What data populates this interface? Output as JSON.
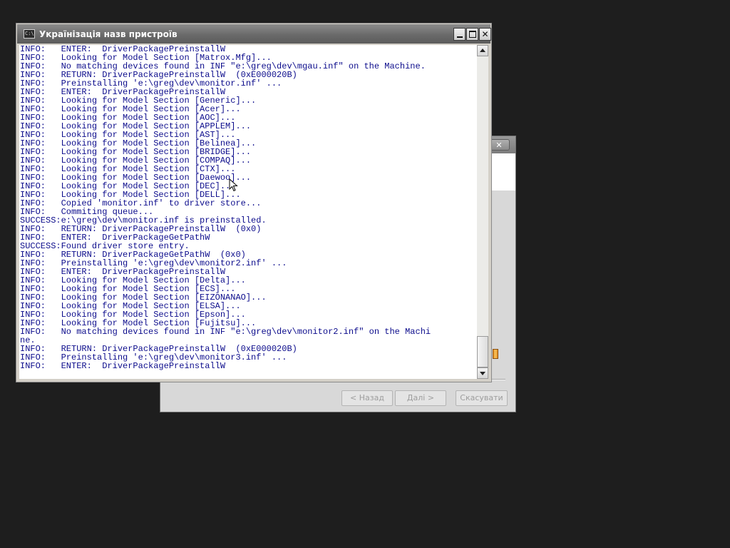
{
  "console_window": {
    "title": "Українізація назв пристроїв",
    "app_icon_label": "C:\\",
    "close_glyph": "✕",
    "lines": [
      "INFO:   ENTER:  DriverPackagePreinstallW",
      "INFO:   Looking for Model Section [Matrox.Mfg]...",
      "INFO:   No matching devices found in INF \"e:\\greg\\dev\\mgau.inf\" on the Machine.",
      "INFO:   RETURN: DriverPackagePreinstallW  (0xE000020B)",
      "INFO:   Preinstalling 'e:\\greg\\dev\\monitor.inf' ...",
      "INFO:   ENTER:  DriverPackagePreinstallW",
      "INFO:   Looking for Model Section [Generic]...",
      "INFO:   Looking for Model Section [Acer]...",
      "INFO:   Looking for Model Section [AOC]...",
      "INFO:   Looking for Model Section [APPLEM]...",
      "INFO:   Looking for Model Section [AST]...",
      "INFO:   Looking for Model Section [Belinea]...",
      "INFO:   Looking for Model Section [BRIDGE]...",
      "INFO:   Looking for Model Section [COMPAQ]...",
      "INFO:   Looking for Model Section [CTX]...",
      "INFO:   Looking for Model Section [Daewoo]...",
      "INFO:   Looking for Model Section [DEC]...",
      "INFO:   Looking for Model Section [DELL]...",
      "INFO:   Copied 'monitor.inf' to driver store...",
      "INFO:   Commiting queue...",
      "SUCCESS:e:\\greg\\dev\\monitor.inf is preinstalled.",
      "INFO:   RETURN: DriverPackagePreinstallW  (0x0)",
      "INFO:   ENTER:  DriverPackageGetPathW",
      "SUCCESS:Found driver store entry.",
      "INFO:   RETURN: DriverPackageGetPathW  (0x0)",
      "INFO:   Preinstalling 'e:\\greg\\dev\\monitor2.inf' ...",
      "INFO:   ENTER:  DriverPackagePreinstallW",
      "INFO:   Looking for Model Section [Delta]...",
      "INFO:   Looking for Model Section [ECS]...",
      "INFO:   Looking for Model Section [EIZONANAO]...",
      "INFO:   Looking for Model Section [ELSA]...",
      "INFO:   Looking for Model Section [Epson]...",
      "INFO:   Looking for Model Section [Fujitsu]...",
      "INFO:   No matching devices found in INF \"e:\\greg\\dev\\monitor2.inf\" on the Machi",
      "ne.",
      "INFO:   RETURN: DriverPackagePreinstallW  (0xE000020B)",
      "INFO:   Preinstalling 'e:\\greg\\dev\\monitor3.inf' ...",
      "INFO:   ENTER:  DriverPackagePreinstallW"
    ]
  },
  "wizard_window": {
    "close_glyph": "✕",
    "back_label": "< Назад",
    "next_label": "Далі >",
    "cancel_label": "Скасувати"
  },
  "icons": {
    "scroll_up": "up-arrow-icon",
    "scroll_down": "down-arrow-icon",
    "app": "console-icon",
    "cursor": "mouse-pointer-icon"
  },
  "colors": {
    "console_text": "#0c0c8c",
    "console_background": "#ffffff",
    "desktop": "#1e1e1e"
  }
}
